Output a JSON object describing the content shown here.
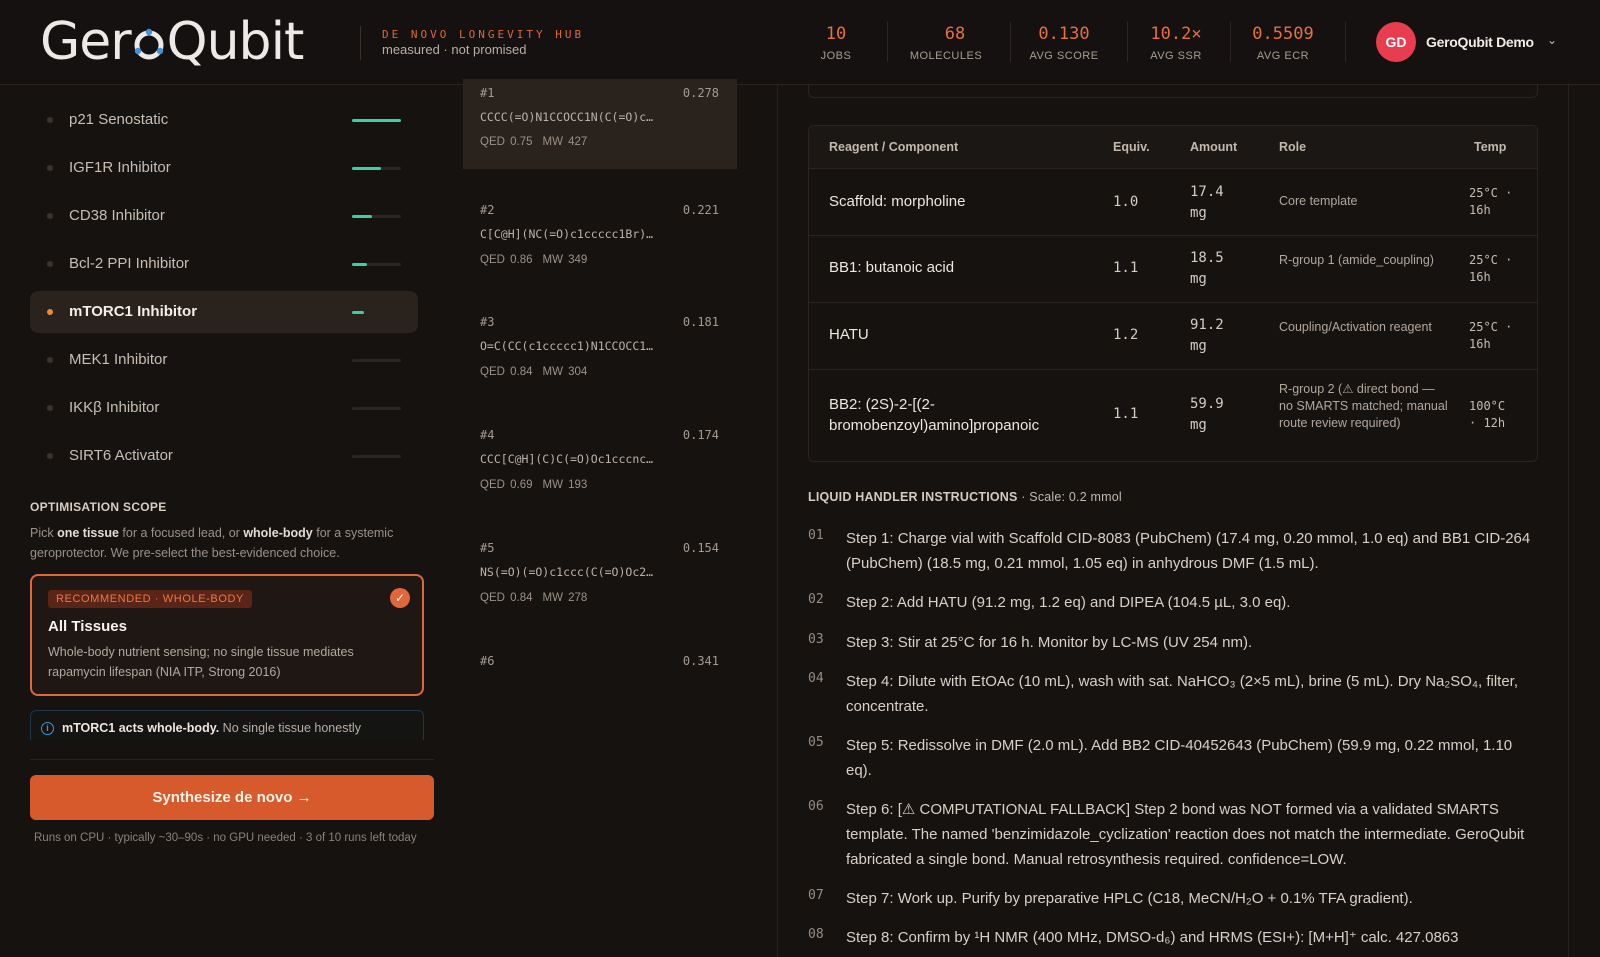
{
  "header": {
    "logo_pre": "Ger",
    "logo_post": "Qubit",
    "tagline_top": "DE NOVO LONGEVITY HUB",
    "tagline_bottom": "measured · not promised",
    "stats": [
      {
        "value": "10",
        "label": "JOBS"
      },
      {
        "value": "68",
        "label": "MOLECULES"
      },
      {
        "value": "0.130",
        "label": "AVG SCORE"
      },
      {
        "value": "10.2×",
        "label": "AVG SSR"
      },
      {
        "value": "0.5509",
        "label": "AVG ECR"
      }
    ],
    "avatar": "GD",
    "user": "GeroQubit Demo"
  },
  "colors": {
    "accent": "#e0673a",
    "progress": "#33d5a4",
    "avatar": "#e83c4f",
    "info": "#3f93d8"
  },
  "targets": [
    {
      "name": "p21 Senostatic",
      "progress": 1.0
    },
    {
      "name": "IGF1R Inhibitor",
      "progress": 0.6
    },
    {
      "name": "CD38 Inhibitor",
      "progress": 0.4
    },
    {
      "name": "Bcl-2 PPI Inhibitor",
      "progress": 0.3
    },
    {
      "name": "mTORC1 Inhibitor",
      "progress": 0.25,
      "active": true
    },
    {
      "name": "MEK1 Inhibitor",
      "progress": 0.0
    },
    {
      "name": "IKKβ Inhibitor",
      "progress": 0.0
    },
    {
      "name": "SIRT6 Activator",
      "progress": 0.0
    }
  ],
  "scope": {
    "title": "OPTIMISATION SCOPE",
    "desc_1": "Pick ",
    "desc_b1": "one tissue",
    "desc_2": " for a focused lead, or ",
    "desc_b2": "whole-body",
    "desc_3": " for a systemic geroprotector. We pre-select the best-evidenced choice.",
    "rec_badge": "RECOMMENDED · WHOLE-BODY",
    "rec_title": "All Tissues",
    "rec_desc": "Whole-body nutrient sensing; no single tissue mediates rapamycin lifespan (NIA ITP, Strong 2016)",
    "info_bold": "mTORC1 acts whole-body.",
    "info_rest": " No single tissue honestly"
  },
  "action": {
    "button": "Synthesize de novo →",
    "note": "Runs on CPU · typically ~30–90s · no GPU needed · 3 of 10 runs left today"
  },
  "molecules": [
    {
      "rank": "#1",
      "score": "0.278",
      "smiles": "CCCC(=O)N1CCOCC1N(C(=O)c…",
      "qed": "QED 0.75",
      "mw": "MW 427",
      "active": true
    },
    {
      "rank": "#2",
      "score": "0.221",
      "smiles": "C[C@H](NC(=O)c1ccccc1Br)…",
      "qed": "QED 0.86",
      "mw": "MW 349"
    },
    {
      "rank": "#3",
      "score": "0.181",
      "smiles": "O=C(CC(c1ccccc1)N1CCOCC1…",
      "qed": "QED 0.84",
      "mw": "MW 304"
    },
    {
      "rank": "#4",
      "score": "0.174",
      "smiles": "CCC[C@H](C)C(=O)Oc1cccnc…",
      "qed": "QED 0.69",
      "mw": "MW 193"
    },
    {
      "rank": "#5",
      "score": "0.154",
      "smiles": "NS(=O)(=O)c1ccc(C(=O)Oc2…",
      "qed": "QED 0.84",
      "mw": "MW 278"
    },
    {
      "rank": "#6",
      "score": "0.341",
      "smiles": "",
      "qed": "",
      "mw": ""
    }
  ],
  "table": {
    "headers": [
      "Reagent / Component",
      "Equiv.",
      "Amount",
      "Role",
      "Temp"
    ],
    "rows": [
      {
        "name": "Scaffold: morpholine",
        "equiv": "1.0",
        "amount": "17.4 mg",
        "role": "Core template",
        "temp": "25°C · 16h"
      },
      {
        "name": "BB1: butanoic acid",
        "equiv": "1.1",
        "amount": "18.5 mg",
        "role": "R-group 1 (amide_coupling)",
        "temp": "25°C · 16h"
      },
      {
        "name": "HATU",
        "equiv": "1.2",
        "amount": "91.2 mg",
        "role": "Coupling/Activation reagent",
        "temp": "25°C · 16h"
      },
      {
        "name": "BB2: (2S)-2-[(2-bromobenzoyl)amino]propanoic",
        "equiv": "1.1",
        "amount": "59.9 mg",
        "role": "R-group 2 (⚠ direct bond — no SMARTS matched; manual route review required)",
        "temp": "100°C · 12h"
      }
    ]
  },
  "liquid_handler": {
    "title": "LIQUID HANDLER INSTRUCTIONS",
    "scale": " · Scale: 0.2 mmol",
    "steps": [
      {
        "num": "01",
        "text": "Step 1: Charge vial with Scaffold CID-8083 (PubChem) (17.4 mg, 0.20 mmol, 1.0 eq) and BB1 CID-264 (PubChem) (18.5 mg, 0.21 mmol, 1.05 eq) in anhydrous DMF (1.5 mL)."
      },
      {
        "num": "02",
        "text": "Step 2: Add HATU (91.2 mg, 1.2 eq) and DIPEA (104.5 µL, 3.0 eq)."
      },
      {
        "num": "03",
        "text": "Step 3: Stir at 25°C for 16 h. Monitor by LC-MS (UV 254 nm)."
      },
      {
        "num": "04",
        "text": "Step 4: Dilute with EtOAc (10 mL), wash with sat. NaHCO₃ (2×5 mL), brine (5 mL). Dry Na₂SO₄, filter, concentrate."
      },
      {
        "num": "05",
        "text": "Step 5: Redissolve in DMF (2.0 mL). Add BB2 CID-40452643 (PubChem) (59.9 mg, 0.22 mmol, 1.10 eq)."
      },
      {
        "num": "06",
        "text": "Step 6: [⚠ COMPUTATIONAL FALLBACK] Step 2 bond was NOT formed via a validated SMARTS template. The named 'benzimidazole_cyclization' reaction does not match the intermediate. GeroQubit fabricated a single bond. Manual retrosynthesis required. confidence=LOW."
      },
      {
        "num": "07",
        "text": "Step 7: Work up. Purify by preparative HPLC (C18, MeCN/H₂O + 0.1% TFA gradient)."
      },
      {
        "num": "08",
        "text": "Step 8: Confirm by ¹H NMR (400 MHz, DMSO-d₆) and HRMS (ESI+): [M+H]⁺ calc. 427.0863"
      }
    ]
  }
}
